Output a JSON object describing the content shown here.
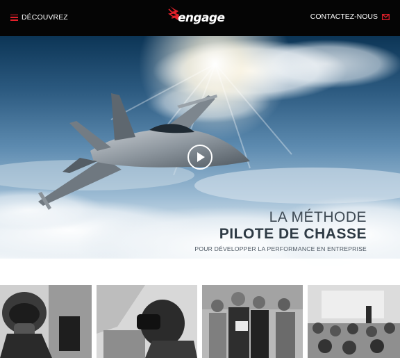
{
  "header": {
    "menu_label": "DÉCOUVREZ",
    "logo_text": "engage",
    "contact_label": "CONTACTEZ-NOUS"
  },
  "hero": {
    "line1": "LA MÉTHODE",
    "line2": "PILOTE DE CHASSE",
    "line3": "POUR DÉVELOPPER LA PERFORMANCE EN ENTREPRISE",
    "play_icon": "play-icon"
  },
  "colors": {
    "accent": "#e3202a",
    "header_bg": "#050505",
    "hero_text": "#2e3a44"
  },
  "icons": [
    "hamburger-menu-icon",
    "engage-wing-logo-icon",
    "mail-icon",
    "play-icon"
  ]
}
